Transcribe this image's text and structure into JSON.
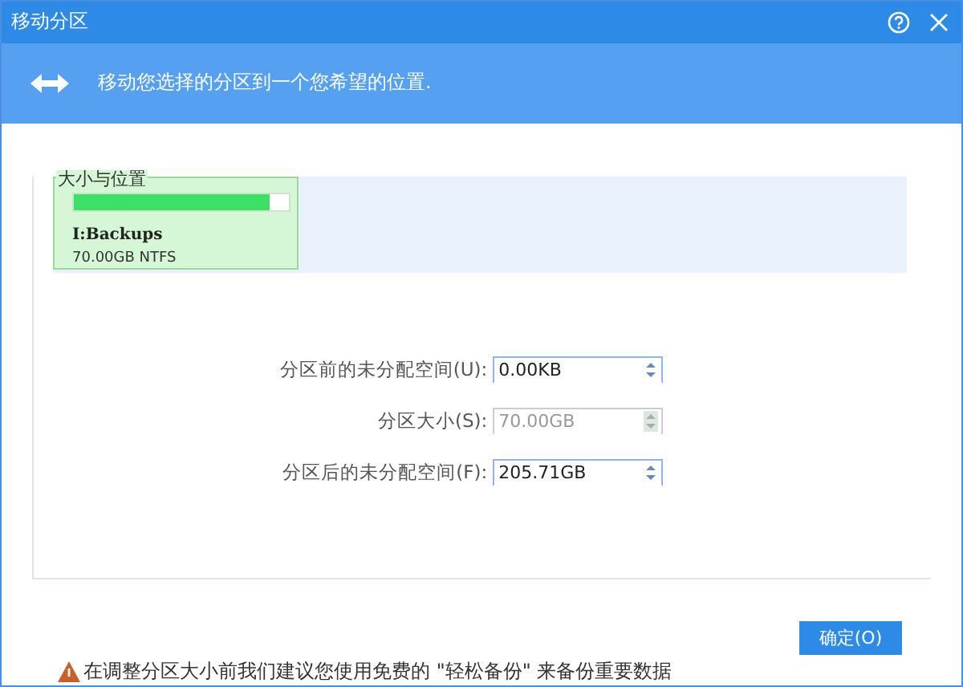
{
  "window": {
    "title": "移动分区"
  },
  "banner": {
    "text": "移动您选择的分区到一个您希望的位置."
  },
  "group": {
    "title": "大小与位置"
  },
  "partition": {
    "name": "I:Backups",
    "size": "70.00GB NTFS",
    "level": 0.91
  },
  "fields": [
    {
      "label": "分区前的未分配空间(U):",
      "value": "0.00KB",
      "disabled": false
    },
    {
      "label": "分区大小(S):",
      "value": "70.00GB",
      "disabled": true
    },
    {
      "label": "分区后的未分配空间(F):",
      "value": "205.71GB",
      "disabled": false
    }
  ],
  "buttons": [
    {
      "label": "确定(O)"
    }
  ],
  "warning": {
    "text": "在调整分区大小前我们建议您使用免费的 \"轻松备份\" 来备份重要数据"
  }
}
